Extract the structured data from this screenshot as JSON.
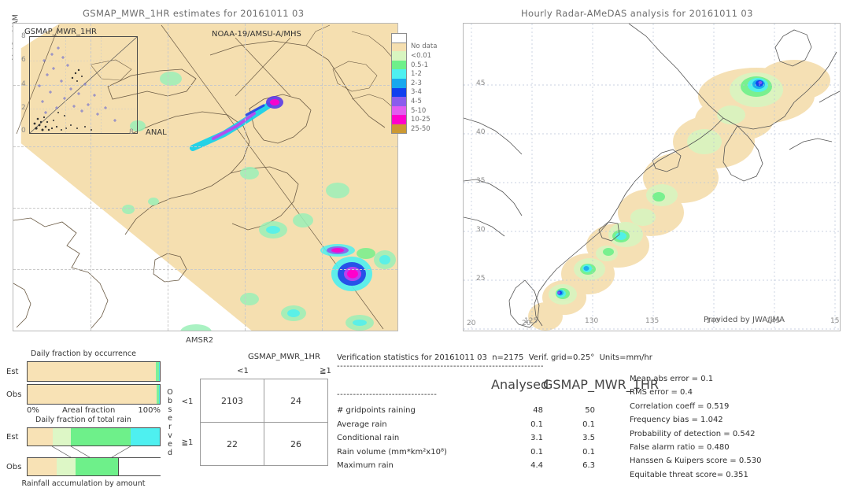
{
  "left_panel": {
    "title": "GSMAP_MWR_1HR estimates for 20161011 03",
    "rotated_label": "MetOp-A/AM",
    "inset_label": "GSMAP_MWR_1HR",
    "sensor_label": "NOAA-19/AMSU-A/MHS",
    "anal_label": "ANAL",
    "anal_tick": "8",
    "bottom_label": "AMSR2",
    "inset_yticks": [
      "8",
      "6",
      "4",
      "2",
      "0"
    ]
  },
  "right_panel": {
    "title": "Hourly Radar-AMeDAS analysis for 20161011 03",
    "credit": "Provided by JWA/JMA",
    "xticks": [
      "120",
      "125",
      "130",
      "135",
      "140",
      "145",
      "15"
    ],
    "yticks": [
      "45",
      "40",
      "35",
      "30",
      "25",
      "20"
    ],
    "corner_tick": "20"
  },
  "colorbar": {
    "entries": [
      {
        "label": "",
        "color": "#ffffff"
      },
      {
        "label": "No data",
        "color": "#f5dfb0"
      },
      {
        "label": "<0.01",
        "color": "#d8f5c0"
      },
      {
        "label": "0.5-1",
        "color": "#6ef08a"
      },
      {
        "label": "1-2",
        "color": "#4ef0f0"
      },
      {
        "label": "2-3",
        "color": "#18a8ee"
      },
      {
        "label": "3-4",
        "color": "#1040ee"
      },
      {
        "label": "4-5",
        "color": "#8a5ced"
      },
      {
        "label": "5-10",
        "color": "#e25cf0"
      },
      {
        "label": "10-25",
        "color": "#ff00cc"
      },
      {
        "label": "25-50",
        "color": "#cc9933"
      }
    ]
  },
  "occurrence_chart": {
    "title": "Daily fraction by occurrence",
    "axis_label": "Areal fraction",
    "axis_min": "0%",
    "axis_max": "100%",
    "rows": [
      {
        "label": "Est",
        "segments": [
          {
            "color": "#f8e2b5",
            "pct": 97.2
          },
          {
            "color": "#7cf09a",
            "pct": 2.2
          },
          {
            "color": "#4ef0f0",
            "pct": 0.6
          }
        ]
      },
      {
        "label": "Obs",
        "segments": [
          {
            "color": "#f8e2b5",
            "pct": 97.6
          },
          {
            "color": "#7cf09a",
            "pct": 1.9
          },
          {
            "color": "#4ef0f0",
            "pct": 0.5
          }
        ]
      }
    ]
  },
  "amount_chart": {
    "title": "Daily fraction of total rain",
    "footer": "Rainfall accumulation by amount",
    "rows": [
      {
        "label": "Est",
        "segments": [
          {
            "color": "#f8e2b5",
            "pct": 19
          },
          {
            "color": "#ddf7c6",
            "pct": 14
          },
          {
            "color": "#6ef08a",
            "pct": 45
          },
          {
            "color": "#4ef0f0",
            "pct": 22
          }
        ]
      },
      {
        "label": "Obs",
        "segments": [
          {
            "color": "#f8e2b5",
            "pct": 22
          },
          {
            "color": "#ddf7c6",
            "pct": 14
          },
          {
            "color": "#6ef08a",
            "pct": 32
          }
        ]
      }
    ]
  },
  "contingency": {
    "col_header": "GSMAP_MWR_1HR",
    "col_labels": [
      "<1",
      "≧1"
    ],
    "row_axis_label": "Observed",
    "row_labels": [
      "<1",
      "≧1"
    ],
    "cells": [
      [
        "2103",
        "24"
      ],
      [
        "22",
        "26"
      ]
    ]
  },
  "verification": {
    "header": "Verification statistics for 20161011 03  n=2175  Verif. grid=0.25°  Units=mm/hr",
    "divider": "----------------------------------------------------------------",
    "col_headers": [
      "Analysed",
      "GSMAP_MWR_1HR"
    ],
    "sub_divider": "-------------------------------",
    "rows": [
      {
        "name": "# gridpoints raining",
        "analysed": "48",
        "estimate": "50"
      },
      {
        "name": "Average rain",
        "analysed": "0.1",
        "estimate": "0.1"
      },
      {
        "name": "Conditional rain",
        "analysed": "3.1",
        "estimate": "3.5"
      },
      {
        "name": "Rain volume (mm*km²x10⁸)",
        "analysed": "0.1",
        "estimate": "0.1"
      },
      {
        "name": "Maximum rain",
        "analysed": "4.4",
        "estimate": "6.3"
      }
    ],
    "scores": [
      "Mean abs error = 0.1",
      "RMS error = 0.4",
      "Correlation coeff = 0.519",
      "Frequency bias = 1.042",
      "Probability of detection = 0.542",
      "False alarm ratio = 0.480",
      "Hanssen & Kuipers score = 0.530",
      "Equitable threat score= 0.351"
    ]
  }
}
